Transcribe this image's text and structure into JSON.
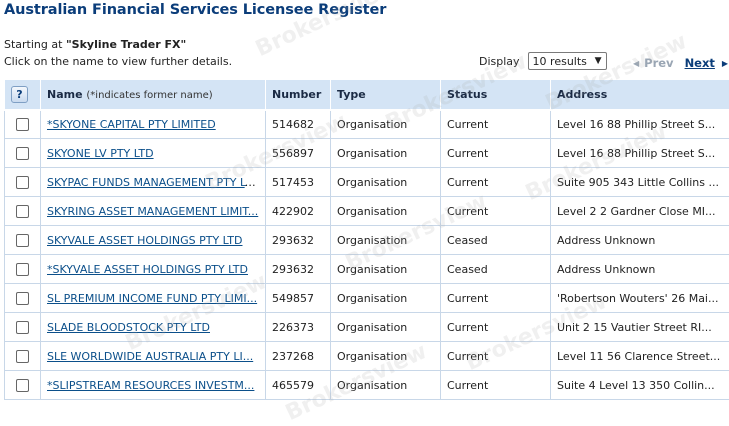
{
  "page": {
    "title": "Australian Financial Services Licensee Register",
    "starting_prefix": "Starting at",
    "starting_value": "\"Skyline Trader FX\"",
    "instruction": "Click on the name to view further details."
  },
  "controls": {
    "display_label": "Display",
    "display_selected": "10 results",
    "prev_label": "Prev",
    "next_label": "Next"
  },
  "watermark": "Brokersview",
  "table": {
    "headers": {
      "name": "Name",
      "name_note": "(*indicates former name)",
      "number": "Number",
      "type": "Type",
      "status": "Status",
      "address": "Address"
    },
    "rows": [
      {
        "name": "*SKYONE CAPITAL PTY LIMITED",
        "number": "514682",
        "type": "Organisation",
        "status": "Current",
        "address": "Level 16 88 Phillip Street S..."
      },
      {
        "name": "SKYONE LV PTY LTD",
        "number": "556897",
        "type": "Organisation",
        "status": "Current",
        "address": "Level 16 88 Phillip Street S..."
      },
      {
        "name": "SKYPAC FUNDS MANAGEMENT PTY LTD",
        "number": "517453",
        "type": "Organisation",
        "status": "Current",
        "address": "Suite 905 343 Little Collins ..."
      },
      {
        "name": "SKYRING ASSET MANAGEMENT LIMIT...",
        "number": "422902",
        "type": "Organisation",
        "status": "Current",
        "address": "Level 2 2 Gardner Close MI..."
      },
      {
        "name": "SKYVALE ASSET HOLDINGS PTY LTD",
        "number": "293632",
        "type": "Organisation",
        "status": "Ceased",
        "address": "Address Unknown"
      },
      {
        "name": "*SKYVALE ASSET HOLDINGS PTY LTD",
        "number": "293632",
        "type": "Organisation",
        "status": "Ceased",
        "address": "Address Unknown"
      },
      {
        "name": "SL PREMIUM INCOME FUND PTY LIMI...",
        "number": "549857",
        "type": "Organisation",
        "status": "Current",
        "address": "'Robertson Wouters' 26 Mai..."
      },
      {
        "name": "SLADE BLOODSTOCK PTY LTD",
        "number": "226373",
        "type": "Organisation",
        "status": "Current",
        "address": "Unit 2 15 Vautier Street RI..."
      },
      {
        "name": "SLE WORLDWIDE AUSTRALIA PTY LI...",
        "number": "237268",
        "type": "Organisation",
        "status": "Current",
        "address": "Level 11 56 Clarence Street..."
      },
      {
        "name": "*SLIPSTREAM RESOURCES INVESTM...",
        "number": "465579",
        "type": "Organisation",
        "status": "Current",
        "address": "Suite 4 Level 13 350 Collin..."
      }
    ]
  }
}
